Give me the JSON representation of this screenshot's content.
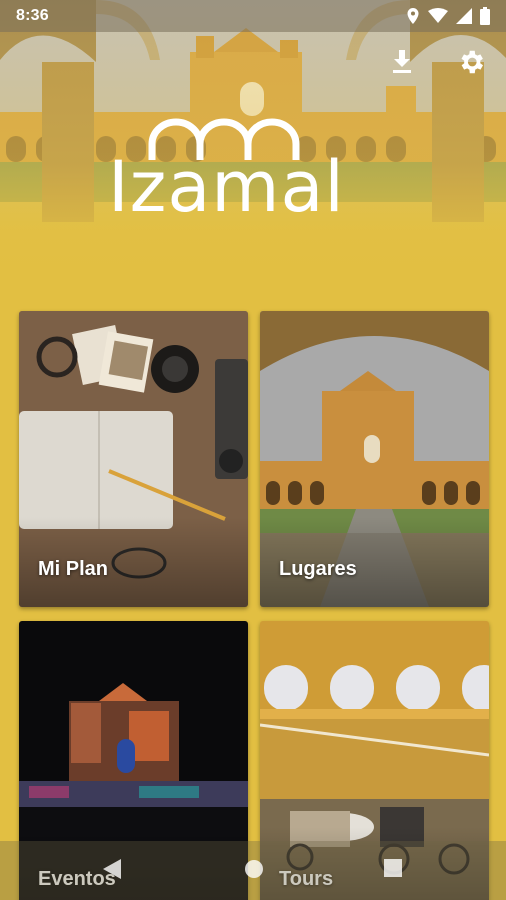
{
  "status_bar": {
    "time": "8:36",
    "icons": [
      "location-icon",
      "wifi-icon",
      "cell-signal-icon",
      "battery-icon"
    ]
  },
  "header": {
    "logo_text": "Izamal",
    "actions": [
      {
        "name": "download-icon"
      },
      {
        "name": "gear-icon"
      }
    ]
  },
  "tiles": [
    {
      "label": "Mi Plan"
    },
    {
      "label": "Lugares"
    },
    {
      "label": "Eventos"
    },
    {
      "label": "Tours"
    }
  ],
  "navigation_bar": {
    "buttons": [
      "back-icon",
      "home-icon",
      "recents-icon"
    ]
  },
  "colors": {
    "background": "#e2bf42",
    "text": "#ffffff",
    "facade_yellow": "#d9a43a"
  }
}
